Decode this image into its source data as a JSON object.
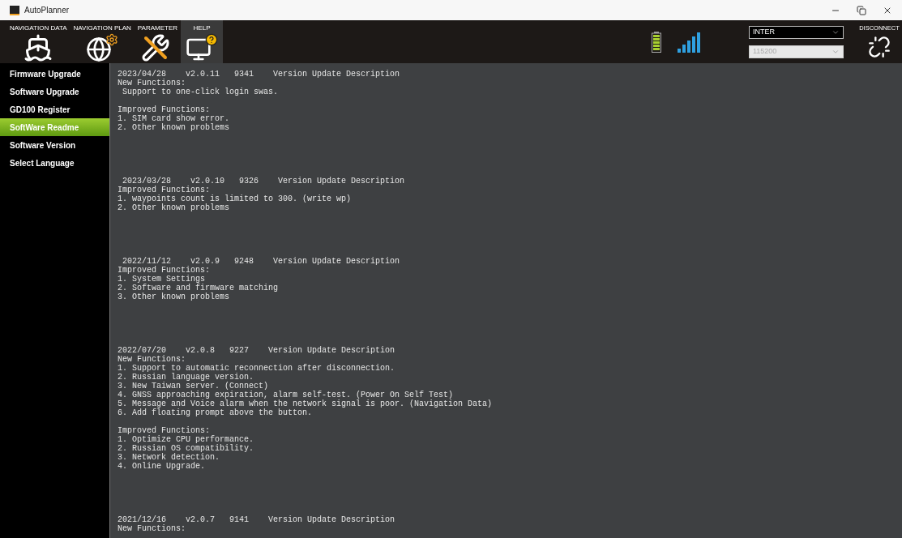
{
  "window": {
    "title": "AutoPlanner"
  },
  "menu_tabs": [
    {
      "label": "NAVIGATION DATA",
      "kind": "ship",
      "selected": false
    },
    {
      "label": "NAVIGATION PLAN",
      "kind": "globe",
      "selected": false
    },
    {
      "label": "PARAMETER",
      "kind": "tools",
      "selected": false
    },
    {
      "label": "HELP",
      "kind": "help",
      "selected": true
    }
  ],
  "connection": {
    "mode": {
      "value": "INTER",
      "disabled": false
    },
    "baud": {
      "value": "115200",
      "disabled": true
    }
  },
  "disconnect": {
    "label": "DISCONNECT"
  },
  "sidebar": {
    "items": [
      {
        "label": "Firmware Upgrade",
        "selected": false
      },
      {
        "label": "Software Upgrade",
        "selected": false
      },
      {
        "label": "GD100 Register",
        "selected": false
      },
      {
        "label": "SoftWare Readme",
        "selected": true
      },
      {
        "label": "Software Version",
        "selected": false
      },
      {
        "label": "Select Language",
        "selected": false
      }
    ]
  },
  "readme": {
    "entries": [
      {
        "header": "2023/04/28    v2.0.11   9341    Version Update Description",
        "sections": [
          {
            "title": "New Functions:",
            "items": [
              " Support to one-click login swas."
            ]
          },
          {
            "title": "Improved Functions:",
            "items": [
              "1. SIM card show error.",
              "2. Other known problems"
            ]
          }
        ]
      },
      {
        "header": " 2023/03/28    v2.0.10   9326    Version Update Description",
        "sections": [
          {
            "title": "Improved Functions:",
            "items": [
              "1. waypoints count is limited to 300. (write wp)",
              "2. Other known problems"
            ]
          }
        ]
      },
      {
        "header": " 2022/11/12    v2.0.9   9248    Version Update Description",
        "sections": [
          {
            "title": "Improved Functions:",
            "items": [
              "1. System Settings",
              "2. Software and firmware matching",
              "3. Other known problems"
            ]
          }
        ]
      },
      {
        "header": "2022/07/20    v2.0.8   9227    Version Update Description",
        "sections": [
          {
            "title": "New Functions:",
            "items": [
              "1. Support to automatic reconnection after disconnection.",
              "2. Russian language version.",
              "3. New Taiwan server. (Connect)",
              "4. GNSS approaching expiration, alarm self-test. (Power On Self Test)",
              "5. Message and Voice alarm when the network signal is poor. (Navigation Data)",
              "6. Add floating prompt above the button."
            ]
          },
          {
            "title": "Improved Functions:",
            "items": [
              "1. Optimize CPU performance.",
              "2. Russian OS compatibility.",
              "3. Network detection.",
              "4. Online Upgrade."
            ]
          }
        ]
      },
      {
        "header": "2021/12/16    v2.0.7   9141    Version Update Description",
        "sections": [
          {
            "title": "New Functions:"
          }
        ]
      }
    ]
  }
}
